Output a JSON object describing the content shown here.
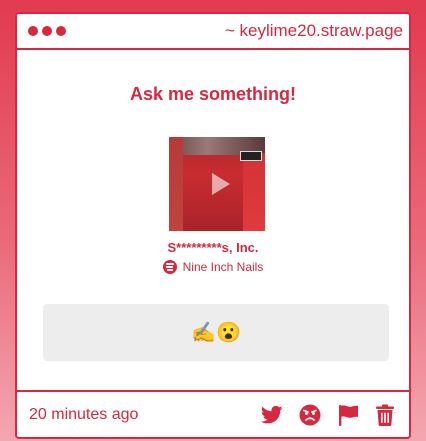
{
  "window": {
    "url_text": "~ keylime20.straw.page"
  },
  "question": {
    "heading": "Ask me something!"
  },
  "music": {
    "track_title": "S*********s, Inc.",
    "artist": "Nine Inch Nails"
  },
  "answer": {
    "emoji": "✍️😮"
  },
  "footer": {
    "timestamp": "20 minutes ago",
    "icons": [
      "twitter-icon",
      "angry-face-icon",
      "flag-icon",
      "trash-icon"
    ]
  },
  "colors": {
    "accent": "#d8283f",
    "answer_bg": "#ededed"
  }
}
